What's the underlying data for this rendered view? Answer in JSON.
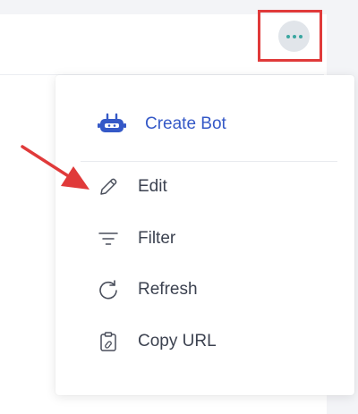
{
  "menu": {
    "items": [
      {
        "label": "Create Bot",
        "icon": "robot-icon"
      },
      {
        "label": "Edit",
        "icon": "pencil-icon"
      },
      {
        "label": "Filter",
        "icon": "filter-icon"
      },
      {
        "label": "Refresh",
        "icon": "refresh-icon"
      },
      {
        "label": "Copy URL",
        "icon": "clipboard-link-icon"
      }
    ]
  },
  "colors": {
    "primary": "#3559c7",
    "highlight": "#e03a3a",
    "more_dots": "#3aa6a0",
    "menu_text": "#3c4250"
  }
}
